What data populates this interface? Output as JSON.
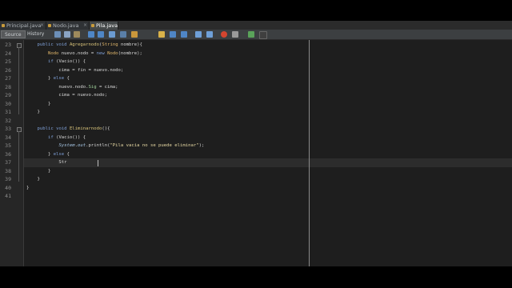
{
  "tabs": [
    {
      "label": "Principal.java",
      "active": false
    },
    {
      "label": "Nodo.java",
      "active": false
    },
    {
      "label": "Pila.java",
      "active": true
    }
  ],
  "toolbar": {
    "source_label": "Source",
    "history_label": "History"
  },
  "editor": {
    "current_line": 37,
    "lines": [
      {
        "no": "23",
        "tokens": [
          [
            "    ",
            ""
          ],
          [
            "public",
            "kw"
          ],
          [
            " ",
            ""
          ],
          [
            "void",
            "kw"
          ],
          [
            " ",
            ""
          ],
          [
            "Agregarnodo",
            "fn"
          ],
          [
            "(",
            ""
          ],
          [
            "String",
            "type"
          ],
          [
            " nombre){",
            ""
          ]
        ]
      },
      {
        "no": "24",
        "tokens": [
          [
            "        ",
            ""
          ],
          [
            "Nodo",
            "type"
          ],
          [
            " nuevo.nodo = ",
            ""
          ],
          [
            "new",
            "kw"
          ],
          [
            " ",
            ""
          ],
          [
            "Nodo",
            "type"
          ],
          [
            "(nombre);",
            ""
          ]
        ]
      },
      {
        "no": "25",
        "tokens": [
          [
            "        ",
            ""
          ],
          [
            "if",
            "kw"
          ],
          [
            " (Vacio()) {",
            ""
          ]
        ]
      },
      {
        "no": "26",
        "tokens": [
          [
            "            cima = fin = nuevo.nodo;",
            ""
          ]
        ]
      },
      {
        "no": "27",
        "tokens": [
          [
            "        } ",
            ""
          ],
          [
            "else",
            "kw"
          ],
          [
            " {",
            ""
          ]
        ]
      },
      {
        "no": "28",
        "tokens": [
          [
            "            nuevo.nodo.",
            ""
          ],
          [
            "Sig",
            "fld"
          ],
          [
            " = cima;",
            ""
          ]
        ]
      },
      {
        "no": "29",
        "tokens": [
          [
            "            cima = nuevo.nodo;",
            ""
          ]
        ]
      },
      {
        "no": "30",
        "tokens": [
          [
            "        }",
            ""
          ]
        ]
      },
      {
        "no": "31",
        "tokens": [
          [
            "    }",
            ""
          ]
        ]
      },
      {
        "no": "32",
        "tokens": []
      },
      {
        "no": "33",
        "tokens": [
          [
            "    ",
            ""
          ],
          [
            "public",
            "kw"
          ],
          [
            " ",
            ""
          ],
          [
            "void",
            "kw"
          ],
          [
            " ",
            ""
          ],
          [
            "Eliminarnodo",
            "fn"
          ],
          [
            "(){",
            ""
          ]
        ]
      },
      {
        "no": "34",
        "tokens": [
          [
            "        ",
            ""
          ],
          [
            "if",
            "kw"
          ],
          [
            " (Vacio()) {",
            ""
          ]
        ]
      },
      {
        "no": "35",
        "tokens": [
          [
            "            ",
            ""
          ],
          [
            "System",
            "static"
          ],
          [
            ".",
            ""
          ],
          [
            "out",
            "static"
          ],
          [
            ".println(",
            ""
          ],
          [
            "\"Pila vacia no se puede eliminar\"",
            "str"
          ],
          [
            ");",
            ""
          ]
        ]
      },
      {
        "no": "36",
        "tokens": [
          [
            "        } ",
            ""
          ],
          [
            "else",
            "kw"
          ],
          [
            " {",
            ""
          ]
        ]
      },
      {
        "no": "37",
        "tokens": [
          [
            "            Str",
            ""
          ]
        ]
      },
      {
        "no": "38",
        "tokens": [
          [
            "        }",
            ""
          ]
        ]
      },
      {
        "no": "39",
        "tokens": [
          [
            "    }",
            ""
          ]
        ]
      },
      {
        "no": "40",
        "tokens": [
          [
            "}",
            ""
          ]
        ]
      },
      {
        "no": "41",
        "tokens": []
      }
    ]
  },
  "colors": {
    "editor_bg": "#1e1e1e",
    "keyword": "#7e9fd6",
    "type": "#e0b66a",
    "string": "#e6d8a3",
    "field": "#9fd19a"
  }
}
